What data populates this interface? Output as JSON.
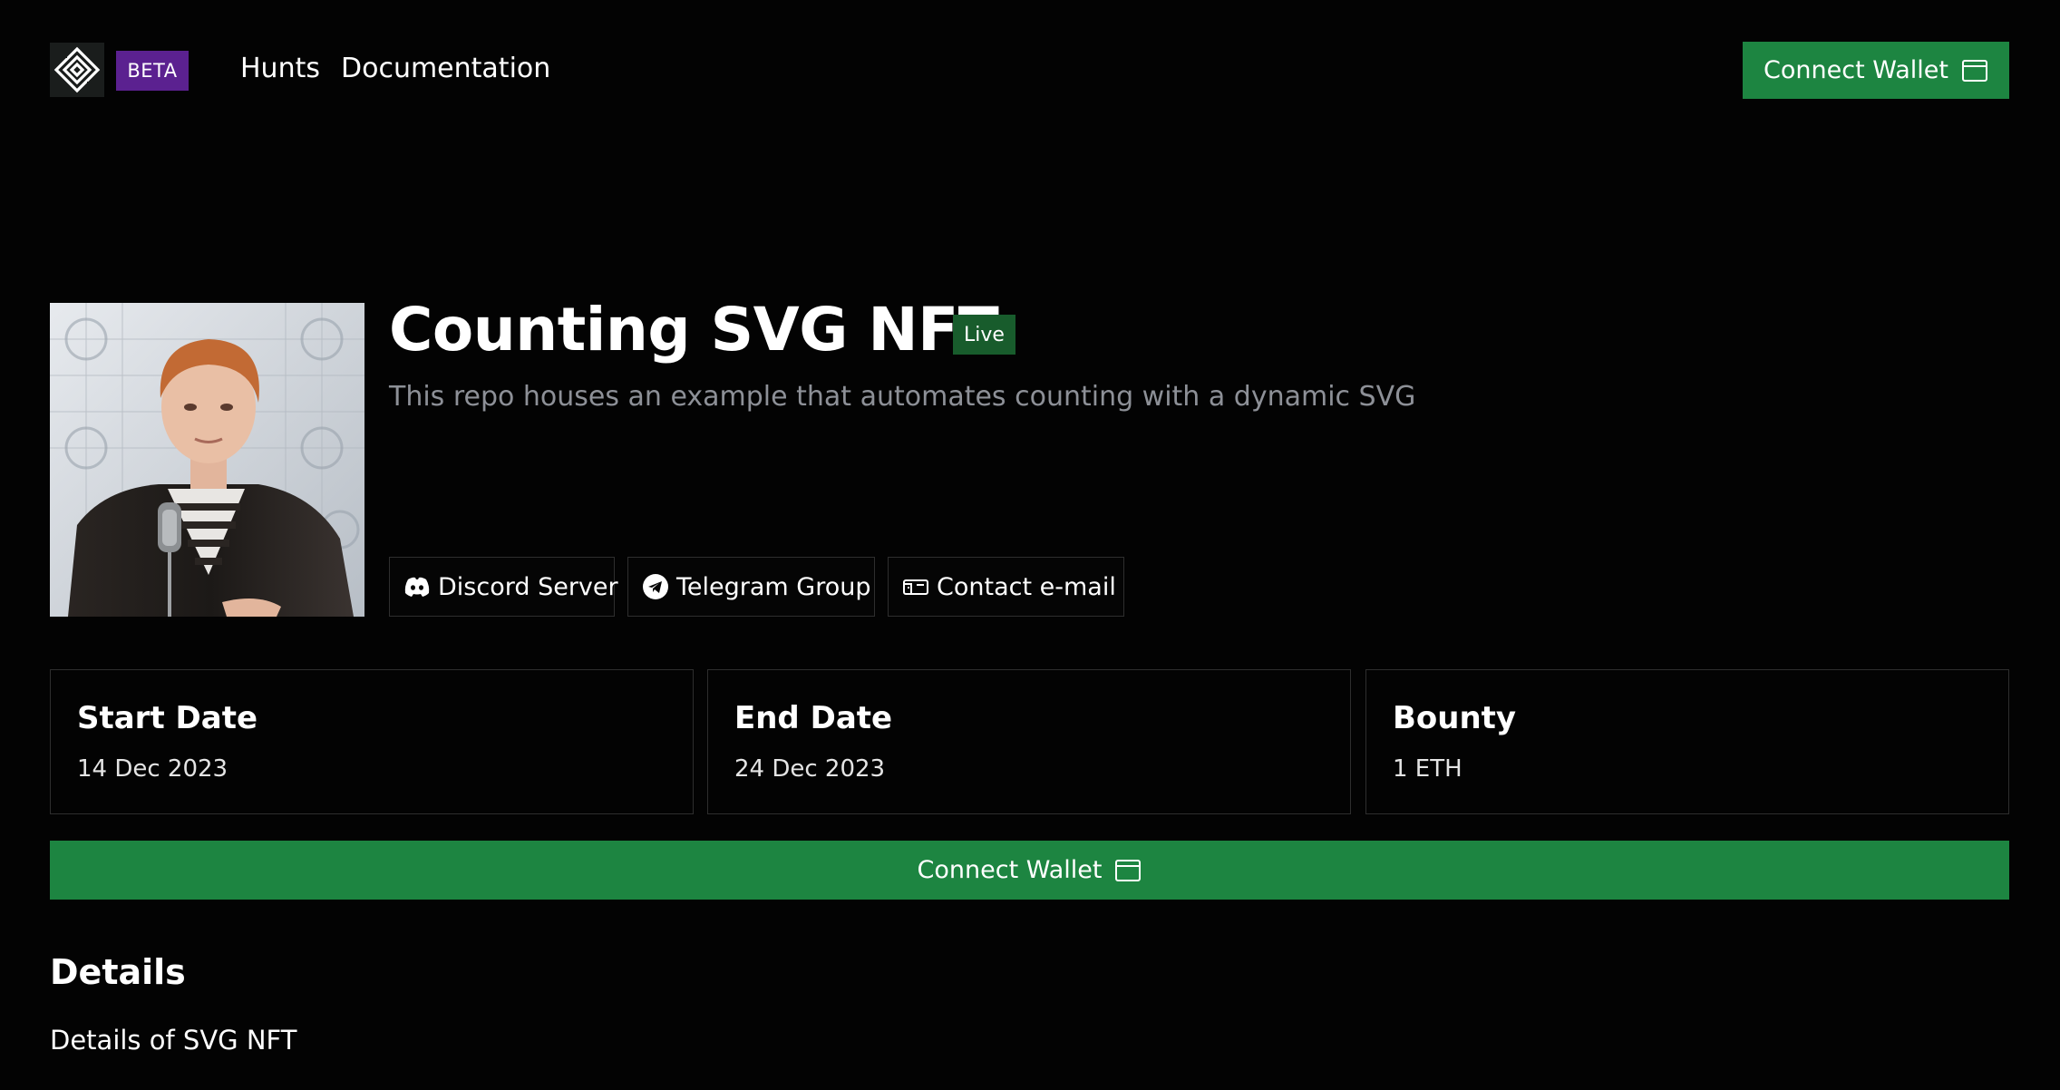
{
  "header": {
    "badge": "BETA",
    "nav": [
      {
        "label": "Hunts"
      },
      {
        "label": "Documentation"
      }
    ],
    "connect_label": "Connect Wallet"
  },
  "hunt": {
    "title": "Counting SVG NFT",
    "status": "Live",
    "description": "This repo houses an example that automates counting with a dynamic SVG",
    "links": [
      {
        "label": "Discord Server",
        "icon": "discord-icon"
      },
      {
        "label": "Telegram Group",
        "icon": "telegram-icon"
      },
      {
        "label": "Contact e-mail",
        "icon": "mail-icon"
      }
    ],
    "stats": [
      {
        "label": "Start Date",
        "value": "14 Dec 2023"
      },
      {
        "label": "End Date",
        "value": "24 Dec 2023"
      },
      {
        "label": "Bounty",
        "value": "1 ETH"
      }
    ],
    "connect_label": "Connect Wallet"
  },
  "details": {
    "heading": "Details",
    "text": "Details of SVG NFT"
  },
  "colors": {
    "background": "#030303",
    "accent_green": "#1d8541",
    "beta_purple": "#5b2190",
    "live_green": "#185c2c",
    "muted_text": "#8d9097"
  }
}
